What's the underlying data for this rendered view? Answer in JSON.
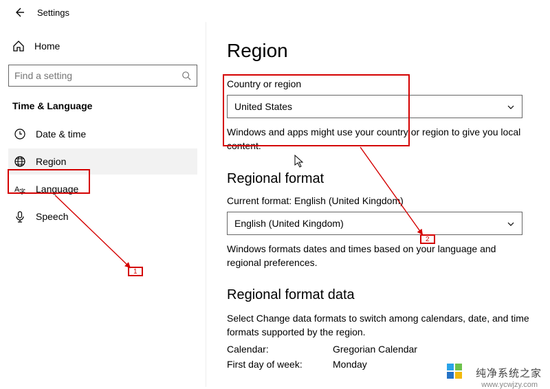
{
  "header": {
    "back_aria": "Back",
    "title": "Settings"
  },
  "sidebar": {
    "home": "Home",
    "search_placeholder": "Find a setting",
    "section": "Time & Language",
    "items": [
      {
        "icon": "clock-icon",
        "label": "Date & time"
      },
      {
        "icon": "globe-icon",
        "label": "Region"
      },
      {
        "icon": "lang-icon",
        "label": "Language"
      },
      {
        "icon": "mic-icon",
        "label": "Speech"
      }
    ]
  },
  "main": {
    "title": "Region",
    "country": {
      "label": "Country or region",
      "value": "United States",
      "desc": "Windows and apps might use your country or region to give you local content."
    },
    "regional_format": {
      "heading": "Regional format",
      "current_label_prefix": "Current format: ",
      "current_value": "English (United Kingdom)",
      "select_value": "English (United Kingdom)",
      "desc": "Windows formats dates and times based on your language and regional preferences."
    },
    "format_data": {
      "heading": "Regional format data",
      "desc": "Select Change data formats to switch among calendars, date, and time formats supported by the region.",
      "rows": [
        {
          "k": "Calendar:",
          "v": "Gregorian Calendar"
        },
        {
          "k": "First day of week:",
          "v": "Monday"
        }
      ]
    }
  },
  "annotations": {
    "badge1": "1",
    "badge2": "2"
  },
  "watermark": {
    "text": "纯净系统之家",
    "url": "www.ycwjzy.com"
  }
}
